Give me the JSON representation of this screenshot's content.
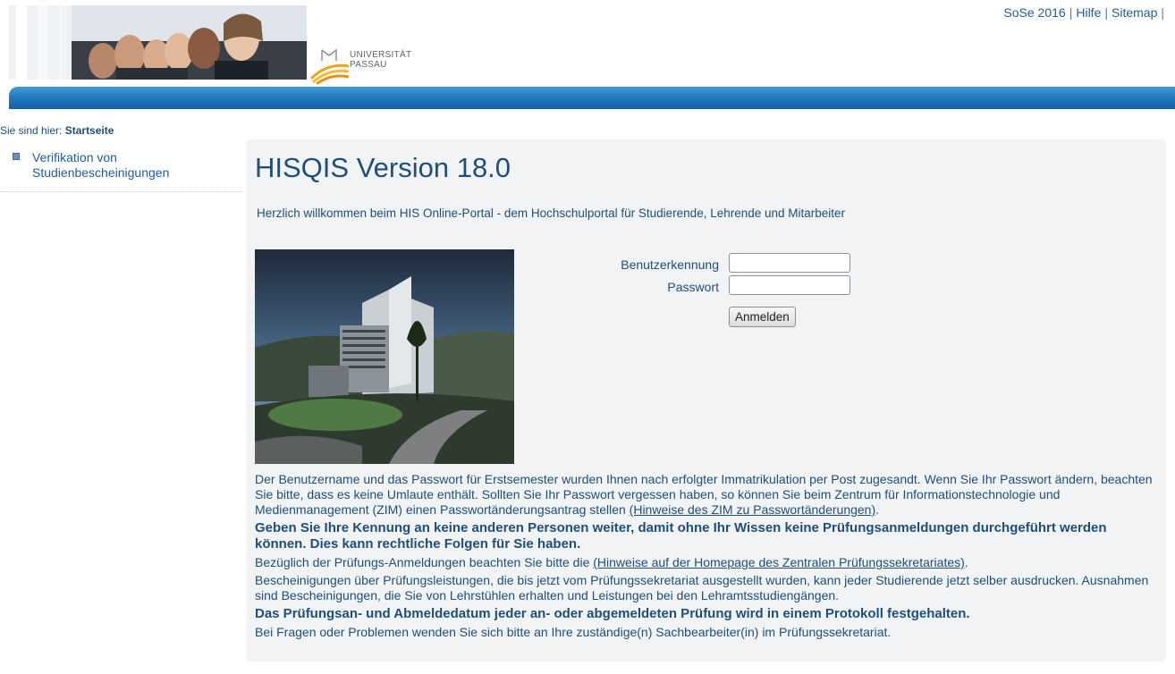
{
  "header": {
    "logo_line1": "UNIVERSITÄT",
    "logo_line2": "PASSAU",
    "nav": {
      "semester": "SoSe 2016",
      "help": "Hilfe",
      "sitemap": "Sitemap",
      "separator": "|"
    }
  },
  "breadcrumb": {
    "prefix": "Sie sind hier:",
    "current": "Startseite"
  },
  "sidebar": {
    "items": [
      {
        "label_line1": "Verifikation von",
        "label_line2": "Studienbescheinigungen"
      }
    ]
  },
  "main": {
    "title": "HISQIS Version 18.0",
    "welcome": "Herzlich willkommen beim HIS Online-Portal - dem Hochschulportal für Studierende, Lehrende und Mitarbeiter",
    "login": {
      "username_label": "Benutzerkennung",
      "password_label": "Passwort",
      "username_value": "",
      "password_value": "",
      "submit_label": "Anmelden"
    },
    "paragraphs": {
      "p1_text": "Der Benutzername und das Passwort für Erstsemester wurden Ihnen nach erfolgter Immatrikulation per Post zugesandt. Wenn Sie Ihr Passwort ändern, beachten Sie bitte, dass es keine Umlaute enthält. Sollten Sie Ihr Passwort vergessen haben, so können Sie beim Zentrum für Informationstechnologie und Medienmanagement (ZIM) einen Passwortänderungsantrag stellen ",
      "p1_link": "(Hinweise des ZIM zu Passwortänderungen)",
      "p1_end": ".",
      "p2_bold": "Geben Sie Ihre Kennung an keine anderen Personen weiter, damit ohne Ihr Wissen keine Prüfungsanmeldungen durchgeführt werden können. Dies kann rechtliche Folgen für Sie haben.",
      "p3_text": "Bezüglich der Prüfungs-Anmeldungen beachten Sie bitte die ",
      "p3_link": "(Hinweise auf der Homepage des Zentralen Prüfungssekretariates)",
      "p3_end": ".",
      "p4_text": "Bescheinigungen über Prüfungsleistungen, die bis jetzt vom Prüfungssekretariat ausgestellt wurden, kann jeder Studierende jetzt selber ausdrucken. Ausnahmen sind Bescheinigungen, die Sie von Lehrstühlen erhalten und Leistungen bei den Lehramtsstudiengängen.",
      "p5_bold": "Das Prüfungsan- und Abmeldedatum jeder an- oder abgemeldeten Prüfung wird in einem Protokoll festgehalten.",
      "p6_text": "Bei Fragen oder Problemen wenden Sie sich bitte an Ihre zuständige(n) Sachbearbeiter(in) im Prüfungssekretariat."
    }
  },
  "colors": {
    "text_blue": "#1f4e79",
    "bar_blue": "#1f74bb",
    "panel_bg": "#f1f3f5"
  }
}
